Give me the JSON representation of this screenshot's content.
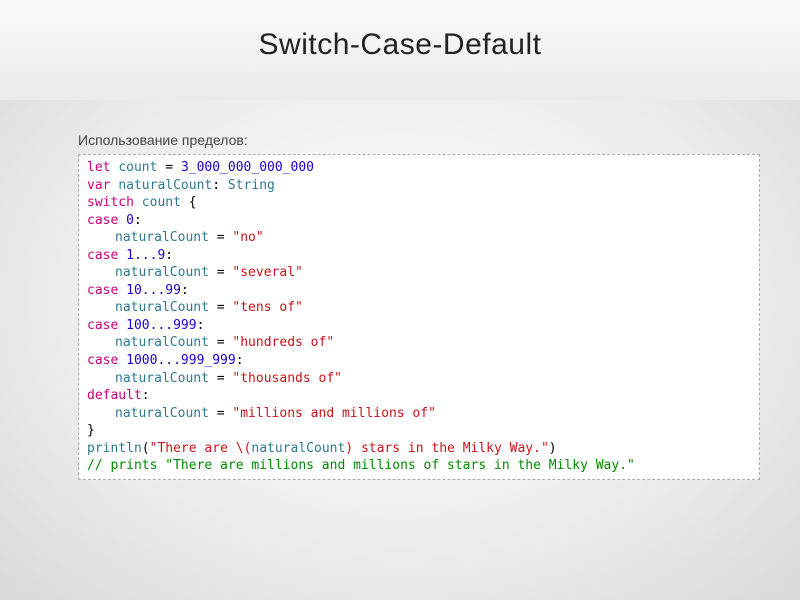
{
  "title": "Switch-Case-Default",
  "subtitle": "Использование пределов:",
  "code": {
    "l1_let": "let",
    "l1_count": "count",
    "l1_eq": "=",
    "l1_val": "3_000_000_000_000",
    "l2_var": "var",
    "l2_nc": "naturalCount",
    "l2_colon": ":",
    "l2_type": "String",
    "l3_switch": "switch",
    "l3_count": "count",
    "l3_brace": "{",
    "l4_case": "case",
    "l4_val": "0",
    "l4_colon": ":",
    "l5_nc": "naturalCount",
    "l5_eq": "=",
    "l5_str": "\"no\"",
    "l6_case": "case",
    "l6_val": "1...9",
    "l6_colon": ":",
    "l7_nc": "naturalCount",
    "l7_eq": "=",
    "l7_str": "\"several\"",
    "l8_case": "case",
    "l8_val": "10...99",
    "l8_colon": ":",
    "l9_nc": "naturalCount",
    "l9_eq": "=",
    "l9_str": "\"tens of\"",
    "l10_case": "case",
    "l10_val": "100...999",
    "l10_colon": ":",
    "l11_nc": "naturalCount",
    "l11_eq": "=",
    "l11_str": "\"hundreds of\"",
    "l12_case": "case",
    "l12_val": "1000...999_999",
    "l12_colon": ":",
    "l13_nc": "naturalCount",
    "l13_eq": "=",
    "l13_str": "\"thousands of\"",
    "l14_default": "default",
    "l14_colon": ":",
    "l15_nc": "naturalCount",
    "l15_eq": "=",
    "l15_str": "\"millions and millions of\"",
    "l16_brace": "}",
    "l17_fn": "println",
    "l17_open": "(",
    "l17_s1": "\"There are ",
    "l17_interp_open": "\\(",
    "l17_nc": "naturalCount",
    "l17_interp_close": ")",
    "l17_s2": " stars in the Milky Way.\"",
    "l17_close": ")",
    "l18_comment": "// prints \"There are millions and millions of stars in the Milky Way.\""
  }
}
